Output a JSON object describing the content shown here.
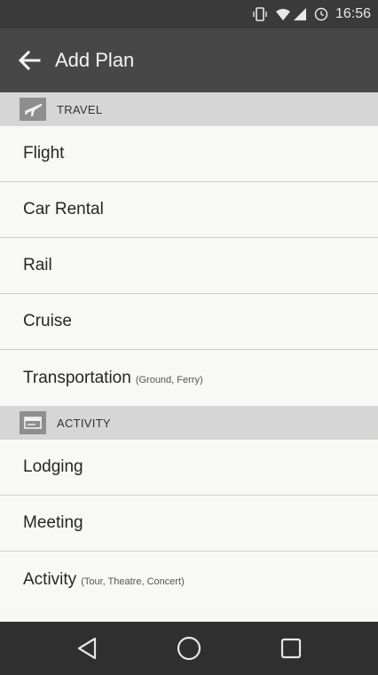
{
  "status_bar": {
    "time": "16:56",
    "icons": [
      "vibrate-icon",
      "wifi-icon",
      "signal-icon",
      "alarm-icon"
    ]
  },
  "app_bar": {
    "title": "Add Plan",
    "back_icon": "arrow-left-icon"
  },
  "sections": [
    {
      "label": "TRAVEL",
      "icon": "airplane-icon",
      "items": [
        {
          "label": "Flight",
          "sub": ""
        },
        {
          "label": "Car Rental",
          "sub": ""
        },
        {
          "label": "Rail",
          "sub": ""
        },
        {
          "label": "Cruise",
          "sub": ""
        },
        {
          "label": "Transportation",
          "sub": "(Ground, Ferry)"
        }
      ]
    },
    {
      "label": "ACTIVITY",
      "icon": "ticket-icon",
      "items": [
        {
          "label": "Lodging",
          "sub": ""
        },
        {
          "label": "Meeting",
          "sub": ""
        },
        {
          "label": "Activity",
          "sub": "(Tour, Theatre, Concert)"
        }
      ]
    }
  ],
  "nav_bar": {
    "icons": [
      "back-triangle-icon",
      "home-circle-icon",
      "recents-square-icon"
    ]
  },
  "colors": {
    "status_bar": "#3a3a3a",
    "app_bar": "#474747",
    "section_header": "#d6d6d6",
    "list_background": "#f8f8f6",
    "nav_bar": "#2f2f2f"
  }
}
